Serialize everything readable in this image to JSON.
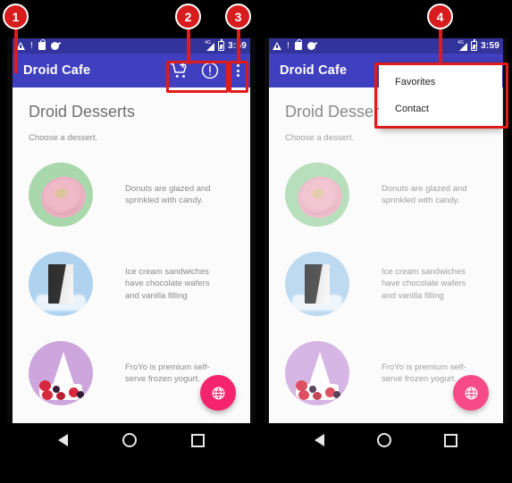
{
  "app": {
    "name": "Droid Cafe",
    "status_bar": {
      "time": "3:59",
      "left_icons": [
        "warning-triangle-icon",
        "exclamation-icon",
        "lock-icon",
        "sync-icon"
      ],
      "right_icons": [
        "signal-4g-icon",
        "battery-icon"
      ],
      "network_label": "4G"
    },
    "appbar": {
      "title": "Droid Cafe",
      "actions": [
        {
          "name": "add-to-cart-icon",
          "label": "Add to cart"
        },
        {
          "name": "info-icon",
          "label": "Info"
        },
        {
          "name": "overflow-menu-icon",
          "label": "More options"
        }
      ],
      "bar_color": "#3f3fbf",
      "status_color": "#33339c"
    },
    "content": {
      "title": "Droid Desserts",
      "subtitle": "Choose a dessert.",
      "desserts": [
        {
          "name": "donut",
          "description": "Donuts are glazed and sprinkled with candy.",
          "bg_color": "#a8d8ac"
        },
        {
          "name": "ice-cream-sandwich",
          "description": "Ice cream sandwiches have chocolate wafers and vanilla filling",
          "bg_color": "#afd2ee"
        },
        {
          "name": "froyo",
          "description": "FroYo is premium self-serve frozen yogurt.",
          "bg_color": "#cda6de"
        }
      ],
      "fab": {
        "icon": "globe-icon",
        "color": "#f4246d"
      }
    },
    "overflow_menu": {
      "items": [
        "Favorites",
        "Contact"
      ]
    },
    "navbar": {
      "buttons": [
        "back-icon",
        "home-icon",
        "recents-icon"
      ]
    }
  },
  "annotations": {
    "accent_color": "#d61c1c",
    "callouts": [
      {
        "number": "1",
        "target": "app-bar-left-edge"
      },
      {
        "number": "2",
        "target": "appbar-action-icons"
      },
      {
        "number": "3",
        "target": "overflow-menu-button"
      },
      {
        "number": "4",
        "target": "overflow-menu-popup"
      }
    ]
  }
}
